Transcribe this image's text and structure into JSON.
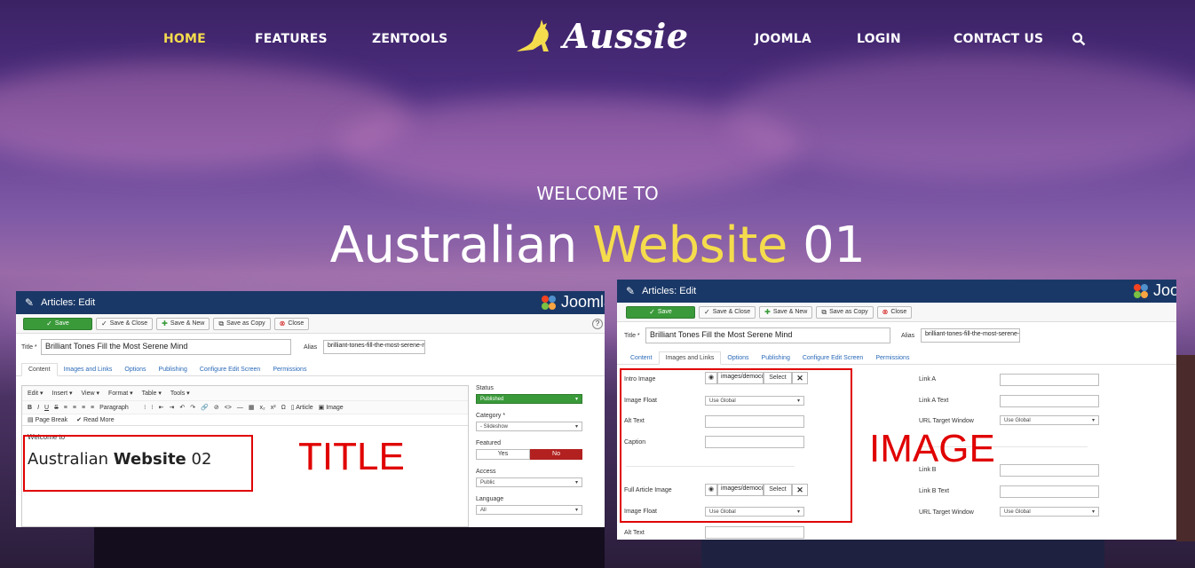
{
  "nav": {
    "left": [
      "HOME",
      "FEATURES",
      "ZENTOOLS"
    ],
    "right": [
      "JOOMLA",
      "LOGIN",
      "CONTACT US"
    ],
    "logo_text": "Aussie",
    "active": "HOME",
    "accent": "#f5dc4d"
  },
  "hero": {
    "subtitle": "WELCOME TO",
    "title_part1": "Australian ",
    "title_highlight": "Website",
    "title_part2": " 01"
  },
  "left_editor": {
    "header": "Articles: Edit",
    "joomla_text": "Joomla",
    "toolbar": [
      "Save",
      "Save & Close",
      "Save & New",
      "Save as Copy",
      "Close"
    ],
    "title_label": "Title *",
    "title_value": "Brilliant Tones Fill the Most Serene Mind",
    "alias_label": "Alias",
    "alias_value": "brilliant-tones-fill-the-most-serene-m",
    "tabs": [
      "Content",
      "Images and Links",
      "Options",
      "Publishing",
      "Configure Edit Screen",
      "Permissions"
    ],
    "active_tab": "Content",
    "menu": [
      "Edit ▾",
      "Insert ▾",
      "View ▾",
      "Format ▾",
      "Table ▾",
      "Tools ▾"
    ],
    "format_select": "Paragraph",
    "fmt_buttons": [
      "B",
      "I",
      "U",
      "S",
      "≡",
      "≡",
      "≡",
      "≡",
      "⁝",
      "⁝",
      "⇤",
      "⇥",
      "↶",
      "↷",
      "🔗",
      "⊘",
      "<>",
      "—",
      "▦",
      "x₂",
      "x²",
      "Ω"
    ],
    "article_btn": "Article",
    "image_btn": "Image",
    "page_break": "Page Break",
    "read_more": "Read More",
    "content_small": "Welcome to",
    "content_large1": "Australian ",
    "content_large_bold": "Website",
    "content_large2": " 02",
    "side": {
      "status_label": "Status",
      "status_value": "Published",
      "category_label": "Category *",
      "category_value": "- Slideshow",
      "featured_label": "Featured",
      "featured_yes": "Yes",
      "featured_no": "No",
      "access_label": "Access",
      "access_value": "Public",
      "language_label": "Language",
      "language_value": "All"
    },
    "callout": "TITLE"
  },
  "right_editor": {
    "header": "Articles: Edit",
    "joomla_text": "Joo",
    "toolbar": [
      "Save",
      "Save & Close",
      "Save & New",
      "Save as Copy",
      "Close"
    ],
    "title_label": "Title *",
    "title_value": "Brilliant Tones Fill the Most Serene Mind",
    "alias_label": "Alias",
    "alias_value": "brilliant-tones-fill-the-most-serene-r",
    "tabs": [
      "Content",
      "Images and Links",
      "Options",
      "Publishing",
      "Configure Edit Screen",
      "Permissions"
    ],
    "active_tab": "Images and Links",
    "intro_image_label": "Intro Image",
    "intro_image_value": "images/democo",
    "select_label": "Select",
    "image_float_label": "Image Float",
    "image_float_value": "Use Global",
    "alt_text_label": "Alt Text",
    "caption_label": "Caption",
    "full_image_label": "Full Article Image",
    "full_image_value": "images/democo",
    "image_float2_label": "Image Float",
    "image_float2_value": "Use Global",
    "alt_text2_label": "Alt Text",
    "link_a_label": "Link A",
    "link_a_text_label": "Link A Text",
    "url_target_label": "URL Target Window",
    "url_target_value": "Use Global",
    "link_b_label": "Link B",
    "link_b_text_label": "Link B Text",
    "url_target2_label": "URL Target Window",
    "url_target2_value": "Use Global",
    "callout": "IMAGE"
  }
}
